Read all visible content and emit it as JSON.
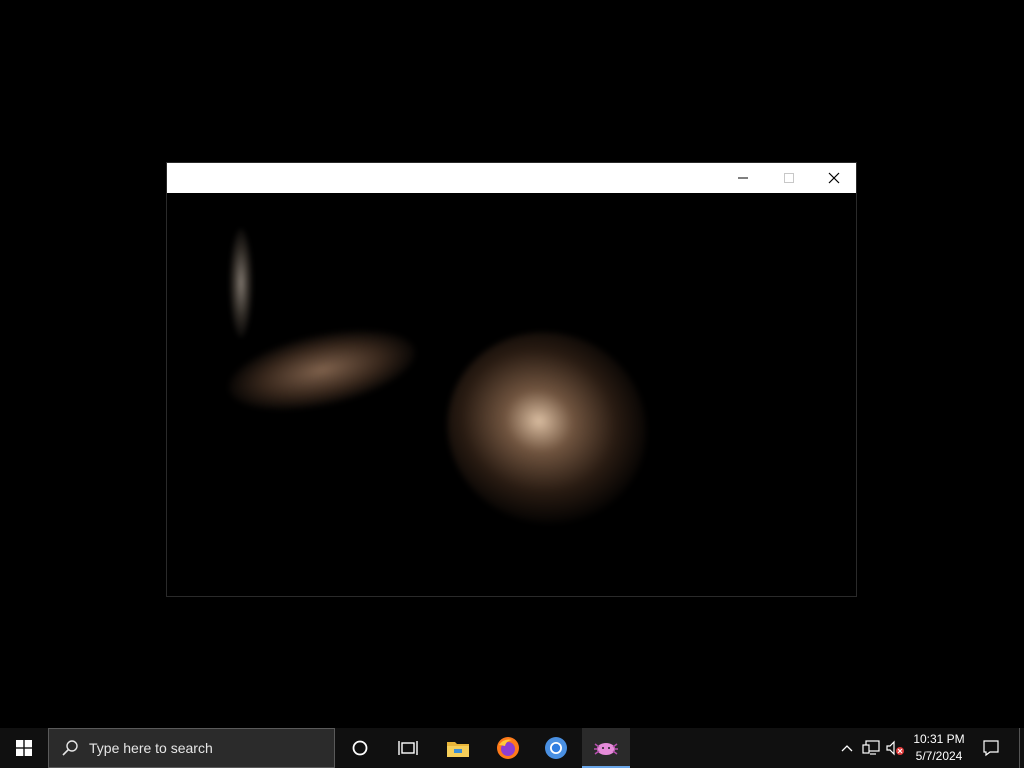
{
  "window": {
    "title": "",
    "controls": {
      "minimize": "minimize",
      "maximize": "maximize",
      "close": "close"
    }
  },
  "taskbar": {
    "search_placeholder": "Type here to search",
    "pinned": [
      {
        "name": "cortana",
        "icon": "circle-icon"
      },
      {
        "name": "task-view",
        "icon": "task-view-icon"
      },
      {
        "name": "file-explorer",
        "icon": "folder-icon"
      },
      {
        "name": "firefox",
        "icon": "firefox-icon"
      },
      {
        "name": "chrome",
        "icon": "chrome-icon"
      },
      {
        "name": "running-app",
        "icon": "axolotl-icon",
        "active": true
      }
    ],
    "tray": {
      "time": "10:31 PM",
      "date": "5/7/2024"
    }
  },
  "colors": {
    "taskbar_bg": "#101010",
    "search_bg": "#2b2b2b",
    "accent": "#6aa6e8",
    "titlebar_bg": "#ffffff"
  }
}
